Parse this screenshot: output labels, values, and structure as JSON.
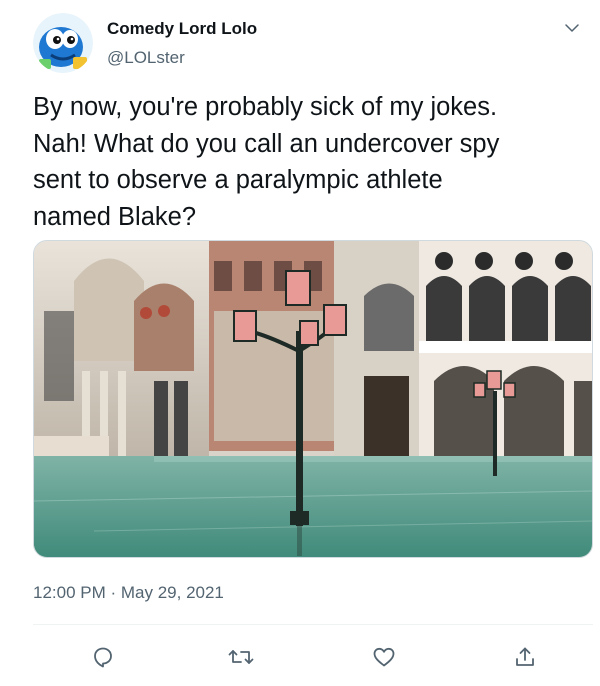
{
  "author": {
    "display_name": "Comedy Lord Lolo",
    "handle": "@LOLster",
    "avatar_icon": "blue-cartoon-mascot-avatar"
  },
  "tweet": {
    "lines": [
      "By now, you're probably sick of my jokes.",
      "Nah! What do you call an undercover spy",
      "sent to observe a paralympic athlete",
      "named Blake?"
    ],
    "photo": "flooded-venice-piazza-with-street-lamps",
    "timestamp": "12:00 PM · May 29, 2021"
  },
  "actions": [
    {
      "name": "reply-button",
      "icon": "reply-icon"
    },
    {
      "name": "retweet-button",
      "icon": "retweet-icon"
    },
    {
      "name": "like-button",
      "icon": "heart-icon"
    },
    {
      "name": "share-button",
      "icon": "share-icon"
    }
  ],
  "colors": {
    "text": "#0f1419",
    "muted": "#536471",
    "icon": "#536471",
    "divider": "#eff3f4"
  }
}
